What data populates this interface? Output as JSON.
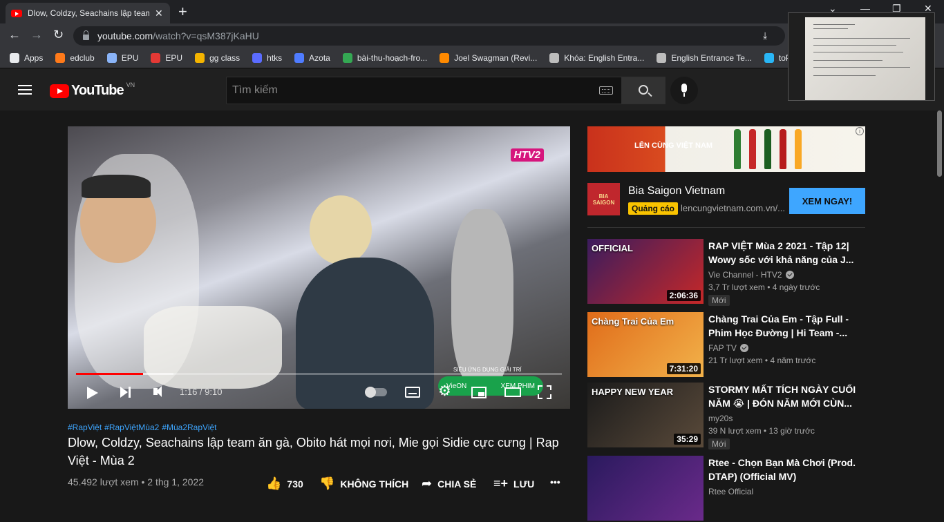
{
  "browser": {
    "tab_title": "Dlow, Coldzy, Seachains lập team",
    "url_host": "youtube.com",
    "url_path": "/watch?v=qsM387jKaHU",
    "bookmarks": [
      {
        "label": "Apps",
        "icon": "apps-grid-icon",
        "color": "#e8eaed"
      },
      {
        "label": "edclub",
        "icon": "edclub-icon",
        "color": "#ff7a1a"
      },
      {
        "label": "EPU",
        "icon": "doc-icon",
        "color": "#8ab4f8"
      },
      {
        "label": "EPU",
        "icon": "globe-icon",
        "color": "#e53935"
      },
      {
        "label": "gg class",
        "icon": "classroom-icon",
        "color": "#f4b400"
      },
      {
        "label": "htks",
        "icon": "globe-icon",
        "color": "#5b6cff"
      },
      {
        "label": "Azota",
        "icon": "azota-icon",
        "color": "#4f7cff"
      },
      {
        "label": "bài-thu-hoạch-fro...",
        "icon": "drive-icon",
        "color": "#34a853"
      },
      {
        "label": "Joel Swagman (Revi...",
        "icon": "blogger-icon",
        "color": "#ff8a00"
      },
      {
        "label": "Khóa: English Entra...",
        "icon": "course-icon",
        "color": "#bdbdbd"
      },
      {
        "label": "English Entrance Te...",
        "icon": "course-icon",
        "color": "#bdbdbd"
      },
      {
        "label": "toP",
        "icon": "top-icon",
        "color": "#29b6f6"
      }
    ]
  },
  "header": {
    "logo_text": "YouTube",
    "country_code": "VN",
    "search_placeholder": "Tìm kiếm"
  },
  "player": {
    "channel_bug": "HTV2",
    "promo_line": "SIÊU ỨNG DỤNG GIẢI TRÍ",
    "promo_brand": "VieON",
    "promo_cta": "XEM PHIM",
    "time_display": "1:16 / 9:10",
    "progress_fraction": 0.138,
    "buffer_fraction": 0.2
  },
  "video": {
    "hashtags": [
      "#RapViệt",
      "#RapViệtMùa2",
      "#Mùa2RapViệt"
    ],
    "title": "Dlow, Coldzy, Seachains lập team ăn gà, Obito hát mọi nơi, Mie gọi Sidie cực cưng | Rap Việt - Mùa 2",
    "views_date": "45.492 lượt xem • 2 thg 1, 2022",
    "like_count": "730",
    "dislike_label": "KHÔNG THÍCH",
    "share_label": "CHIA SẺ",
    "save_label": "LƯU"
  },
  "ad": {
    "banner_slogan": "LÊN CÙNG VIỆT NAM",
    "logo_text": "BIA SAIGON",
    "advertiser": "Bia Saigon Vietnam",
    "badge": "Quảng cáo",
    "url": "lencungvietnam.com.vn/...",
    "cta": "XEM NGAY!"
  },
  "recommendations": [
    {
      "title": "RAP VIỆT Mùa 2 2021 - Tập 12| Wowy sốc với khả năng của J...",
      "channel": "Vie Channel - HTV2",
      "verified": true,
      "meta": "3,7 Tr lượt xem • 4 ngày trước",
      "badge": "Mới",
      "duration": "2:06:36",
      "thumb_overlay": "OFFICIAL",
      "colors": [
        "#3a1c5e",
        "#c62828"
      ]
    },
    {
      "title": "Chàng Trai Của Em - Tập Full - Phim Học Đường | Hi Team -...",
      "channel": "FAP TV",
      "verified": true,
      "meta": "21 Tr lượt xem • 4 năm trước",
      "badge": "",
      "duration": "7:31:20",
      "thumb_overlay": "Chàng Trai Của Em",
      "colors": [
        "#e06c1a",
        "#f2b24a"
      ]
    },
    {
      "title": "STORMY MẤT TÍCH NGÀY CUỐI NĂM 😭 | ĐÓN NĂM MỚI CÙN...",
      "channel": "my20s",
      "verified": false,
      "meta": "39 N lượt xem • 13 giờ trước",
      "badge": "Mới",
      "duration": "35:29",
      "thumb_overlay": "HAPPY NEW YEAR",
      "colors": [
        "#1b1b1b",
        "#5a4a3a"
      ]
    },
    {
      "title": "Rtee - Chọn Bạn Mà Chơi (Prod. DTAP) (Official MV)",
      "channel": "Rtee Official",
      "verified": false,
      "meta": "",
      "badge": "",
      "duration": "",
      "thumb_overlay": "",
      "colors": [
        "#2a1a5e",
        "#6a2a8a"
      ]
    }
  ]
}
